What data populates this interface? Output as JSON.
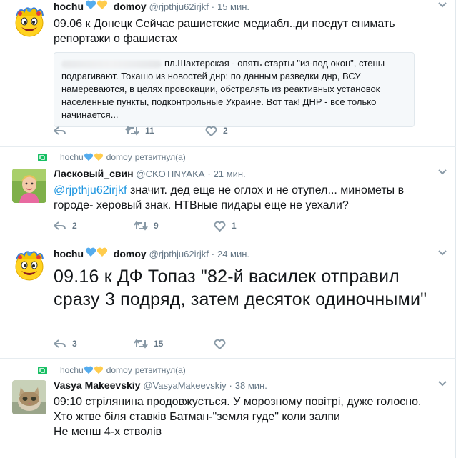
{
  "tweets": [
    {
      "fullname": "hochu",
      "handle": "@rjpthju62irjkf",
      "dot": "·",
      "time": "15 мин.",
      "text": "09.06 к Донецк Сейчас рашистские медиабл..ди поедут снимать репортажи о фашистах",
      "quote": "пл.Шахтерская - опять старты \"из-под окон\", стены подрагивают. Токашо из новостей днр: по данным разведки днр, ВСУ намереваются, в целях провокации, обстрелять из реактивных установок населенные пункты, подконтрольные Украине. Вот так! ДНР - все только начинается...",
      "retweets": "11",
      "likes": "2"
    },
    {
      "rt_by_name": "hochu",
      "rt_by_handle": "domoy",
      "rt_label": "ретвитнул(а)",
      "fullname": "Ласковый_свин",
      "handle": "@CKOTINYAKA",
      "dot": "·",
      "time": "21 мин.",
      "mention": "@rjpthju62irjkf",
      "text": " значит. дед еще  не оглох и не отупел... минометы в городе- херовый знак. НТВные пидары еще не уехали?",
      "replies": "2",
      "retweets": "9",
      "likes": "1"
    },
    {
      "fullname": "hochu",
      "handle": "@rjpthju62irjkf",
      "dot": "·",
      "time": "24 мин.",
      "text": "09.16 к ДФ Топаз \"82-й василек отправил сразу 3 подряд, затем десяток одиночными\"",
      "replies": "3",
      "retweets": "15"
    },
    {
      "rt_by_name": "hochu",
      "rt_by_handle": "domoy",
      "rt_label": "ретвитнул(а)",
      "fullname": "Vasya Makeevskiy",
      "handle": "@VasyaMakeevskiy",
      "dot": "·",
      "time": "38 мин.",
      "lines": [
        "09:10 стрілянина продовжується. У морозному повітрі, дуже голосно.",
        "Хто жтве біля ставків Батман-\"земля гуде\" коли залпи",
        "Не менш 4-х стволів"
      ]
    }
  ],
  "colors": {
    "blue": "#1b95e0",
    "gray": "#657786",
    "heart_blue": "#55acee",
    "heart_yellow": "#ffcc4d",
    "retweet_green": "#17bf63"
  },
  "icons": [
    "reply-icon",
    "retweet-icon",
    "like-icon",
    "caret-down-icon",
    "retweet-context-icon",
    "blue-heart-emoji",
    "yellow-heart-emoji"
  ]
}
